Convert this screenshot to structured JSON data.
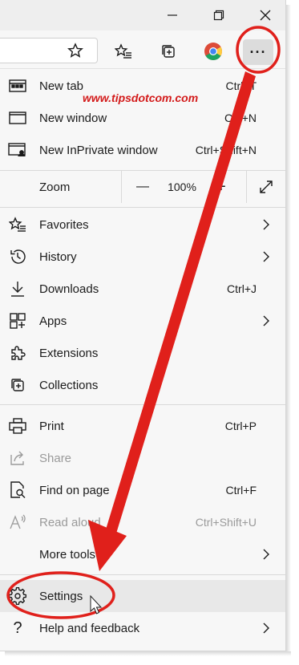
{
  "watermark": "www.tipsdotcom.com",
  "window": {
    "minimize_icon": "minimize-icon",
    "restore_icon": "restore-icon",
    "close_icon": "close-icon"
  },
  "toolbar": {
    "icons": [
      "favorite-star-icon",
      "favorites-list-icon",
      "collections-icon",
      "chrome-extension-icon"
    ],
    "more_label": "···"
  },
  "menu": {
    "top_items": [
      {
        "label": "New tab",
        "shortcut": "Ctrl+T",
        "icon": "new-tab-icon"
      },
      {
        "label": "New window",
        "shortcut": "Ctrl+N",
        "icon": "new-window-icon"
      },
      {
        "label": "New InPrivate window",
        "shortcut": "Ctrl+Shift+N",
        "icon": "inprivate-icon"
      }
    ],
    "zoom": {
      "label": "Zoom",
      "minus": "—",
      "value": "100%",
      "plus": "+"
    },
    "mid_items": [
      {
        "label": "Favorites",
        "shortcut": "",
        "icon": "favorites-icon",
        "submenu": true
      },
      {
        "label": "History",
        "shortcut": "",
        "icon": "history-icon",
        "submenu": true
      },
      {
        "label": "Downloads",
        "shortcut": "Ctrl+J",
        "icon": "download-icon",
        "submenu": false
      },
      {
        "label": "Apps",
        "shortcut": "",
        "icon": "apps-icon",
        "submenu": true
      },
      {
        "label": "Extensions",
        "shortcut": "",
        "icon": "extensions-icon",
        "submenu": false
      },
      {
        "label": "Collections",
        "shortcut": "",
        "icon": "collections-icon",
        "submenu": false
      }
    ],
    "low_items": [
      {
        "label": "Print",
        "shortcut": "Ctrl+P",
        "icon": "print-icon",
        "disabled": false
      },
      {
        "label": "Share",
        "shortcut": "",
        "icon": "share-icon",
        "disabled": true
      },
      {
        "label": "Find on page",
        "shortcut": "Ctrl+F",
        "icon": "find-icon",
        "disabled": false
      },
      {
        "label": "Read aloud",
        "shortcut": "Ctrl+Shift+U",
        "icon": "read-aloud-icon",
        "disabled": true
      },
      {
        "label": "More tools",
        "shortcut": "",
        "icon": "",
        "submenu": true
      }
    ],
    "bottom_items": [
      {
        "label": "Settings",
        "icon": "settings-icon",
        "highlighted": true
      },
      {
        "label": "Help and feedback",
        "icon": "help-icon",
        "submenu": true
      }
    ]
  },
  "annotation_color": "#e0201b"
}
